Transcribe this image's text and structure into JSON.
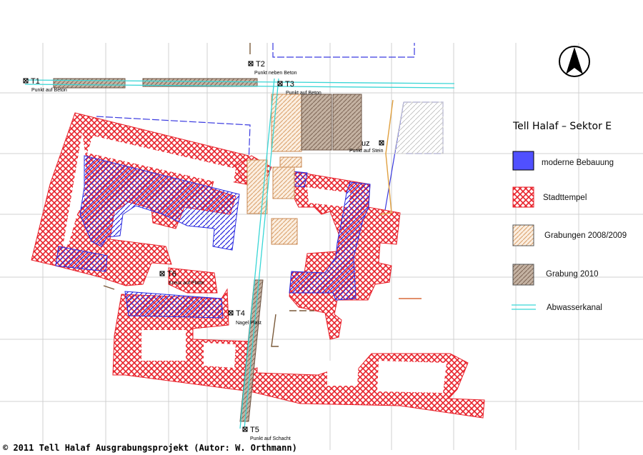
{
  "north_arrow": {
    "icon": "north-arrow-icon"
  },
  "legend": {
    "title": "Tell Halaf – Sektor E",
    "items": [
      {
        "key": "modern",
        "label": "moderne Bebauung",
        "color": "#5050ff"
      },
      {
        "key": "stadttempel",
        "label": "Stadttempel",
        "color": "#e8212a"
      },
      {
        "key": "grabungen_2008_2009",
        "label": "Grabungen 2008/2009",
        "color": "#e8b890"
      },
      {
        "key": "grabung_2010",
        "label": "Grabung 2010",
        "color": "#b7a698"
      },
      {
        "key": "abwasserkanal",
        "label": "Abwasserkanal",
        "color": "#39d6d6"
      }
    ]
  },
  "points": [
    {
      "id": "T1",
      "label": "T1",
      "note": "Punkt auf Beton"
    },
    {
      "id": "T2",
      "label": "T2",
      "note": "Punkt neben Beton"
    },
    {
      "id": "T3",
      "label": "T3",
      "note": "Punkt auf Beton"
    },
    {
      "id": "T4",
      "label": "T4",
      "note": "Nagel Plast"
    },
    {
      "id": "T5",
      "label": "T5",
      "note": "Punkt auf Schacht"
    },
    {
      "id": "T6",
      "label": "T6",
      "note": "Kreuz auf Platte"
    },
    {
      "id": "KREUZ",
      "label": "uz",
      "note": "Punkt auf Stein"
    }
  ],
  "copyright": "© 2011 Tell Halaf Ausgrabungsprojekt (Autor: W. Orthmann)"
}
